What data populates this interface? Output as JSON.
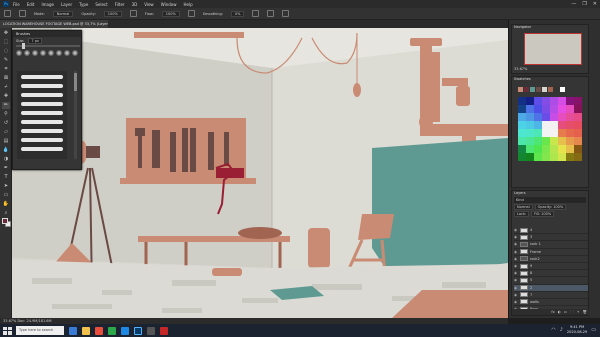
{
  "app": {
    "logo": "Ps",
    "menus": [
      "File",
      "Edit",
      "Image",
      "Layer",
      "Type",
      "Select",
      "Filter",
      "3D",
      "View",
      "Window",
      "Help"
    ],
    "window_controls": [
      "—",
      "❐",
      "✕"
    ]
  },
  "options_bar": {
    "mode_label": "Mode:",
    "mode_value": "Normal",
    "opacity_label": "Opacity:",
    "opacity_value": "100%",
    "flow_label": "Flow:",
    "flow_value": "100%",
    "smoothing_label": "Smoothing:",
    "smoothing_value": "0%"
  },
  "document": {
    "tab_title": "LOCATION WAREHOUSE FOOTAGE WEB.psd @ 33,7% (Layer 11, RGB/8) *"
  },
  "brushes_panel": {
    "title": "Brushes",
    "size_label": "Size:",
    "size_value": "7 px"
  },
  "navigator_panel": {
    "title": "Navigator",
    "zoom": "33.67%"
  },
  "color_panel": {
    "title": "Swatches"
  },
  "layers_panel": {
    "title": "Layers",
    "kind_label": "Kind",
    "blend": "Normal",
    "opacity": "Opacity: 100%",
    "lock": "Lock:",
    "fill": "Fill: 100%",
    "rows": [
      {
        "name": "4",
        "selected": false
      },
      {
        "name": "3",
        "selected": false
      },
      {
        "name": "rock 1",
        "selected": false
      },
      {
        "name": "Frame",
        "selected": false
      },
      {
        "name": "rock2",
        "selected": false
      },
      {
        "name": "9",
        "selected": false
      },
      {
        "name": "8",
        "selected": false
      },
      {
        "name": "5",
        "selected": false
      },
      {
        "name": "2",
        "selected": true
      },
      {
        "name": "7",
        "selected": false
      },
      {
        "name": "walls",
        "selected": false
      },
      {
        "name": "floor",
        "selected": false
      }
    ],
    "footer_icons": [
      "fx",
      "◐",
      "▭",
      "🗀",
      "+",
      "🗑"
    ]
  },
  "status": {
    "text": "33.67%     Doc: 24.9M/181.6M"
  },
  "taskbar": {
    "search_placeholder": "Type here to search",
    "time": "9:41 PM",
    "date": "2020-08-29",
    "app_colors": [
      "#3a7bd5",
      "#f2c14e",
      "#e94e3c",
      "#2aa84a",
      "#1e88e5",
      "#0a3a66",
      "#555555",
      "#c62828"
    ]
  },
  "colors": {
    "fg": "#6b2a3a",
    "wall": "#d7d6cf",
    "accent_terracotta": "#c98b74",
    "teal": "#5f9a92"
  }
}
